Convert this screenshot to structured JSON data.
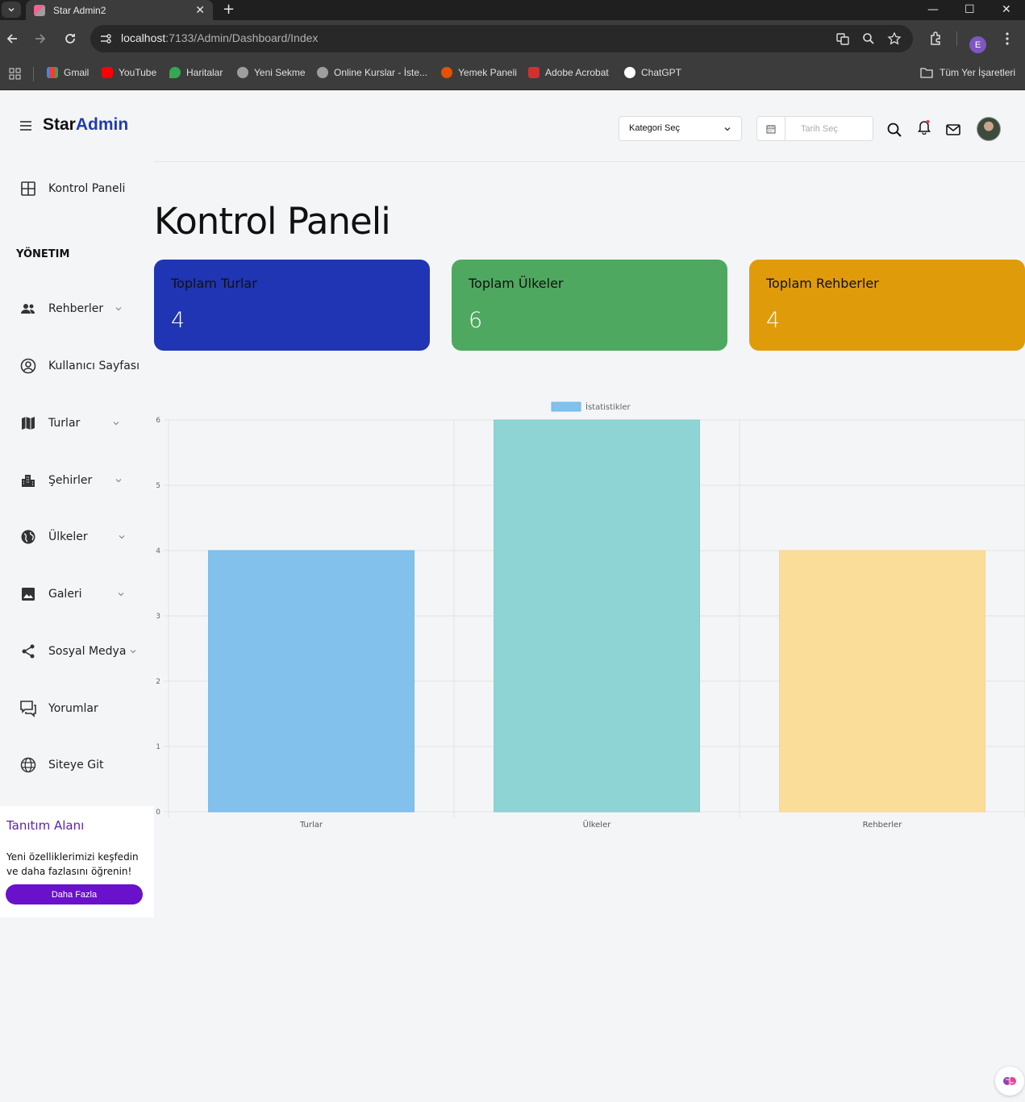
{
  "browser": {
    "tab_title": "Star Admin2",
    "url_host": "localhost",
    "url_rest": ":7133/Admin/Dashboard/Index",
    "profile_initial": "E",
    "bookmarks": [
      "Gmail",
      "YouTube",
      "Haritalar",
      "Yeni Sekme",
      "Online Kurslar - İste...",
      "Yemek Paneli",
      "Adobe Acrobat",
      "ChatGPT"
    ],
    "all_bookmarks": "Tüm Yer İşaretleri"
  },
  "brand": {
    "part1": "Star",
    "part2": "Admin"
  },
  "header": {
    "category_select": "Kategori Seç",
    "date_placeholder": "Tarih Seç"
  },
  "sidebar": {
    "dashboard": "Kontrol Paneli",
    "section": "YÖNETIM",
    "items": [
      "Rehberler",
      "Kullanıcı Sayfası",
      "Turlar",
      "Şehirler",
      "Ülkeler",
      "Galeri",
      "Sosyal Medya",
      "Yorumlar",
      "Siteye Git"
    ]
  },
  "promo": {
    "title": "Tanıtım Alanı",
    "text": "Yeni özelliklerimizi keşfedin ve daha fazlasını öğrenin!",
    "button": "Daha Fazla"
  },
  "page": {
    "title": "Kontrol Paneli"
  },
  "cards": [
    {
      "label": "Toplam Turlar",
      "value": "4",
      "color": "#1f35b3"
    },
    {
      "label": "Toplam Ülkeler",
      "value": "6",
      "color": "#4ea85f"
    },
    {
      "label": "Toplam Rehberler",
      "value": "4",
      "color": "#e09b0b"
    }
  ],
  "chart_data": {
    "type": "bar",
    "categories": [
      "Turlar",
      "Ülkeler",
      "Rehberler"
    ],
    "series": [
      {
        "name": "İstatistikler",
        "values": [
          4,
          6,
          4
        ]
      }
    ],
    "colors": [
      "#82c1ec",
      "#8fd4d5",
      "#fbdd9a"
    ],
    "borders": [
      "#72b6e6",
      "#7fcccd",
      "#f8d48a"
    ],
    "ylim": [
      0,
      6
    ],
    "yticks": [
      0,
      1,
      2,
      3,
      4,
      5,
      6
    ],
    "grid": true,
    "legend": "top-center"
  }
}
